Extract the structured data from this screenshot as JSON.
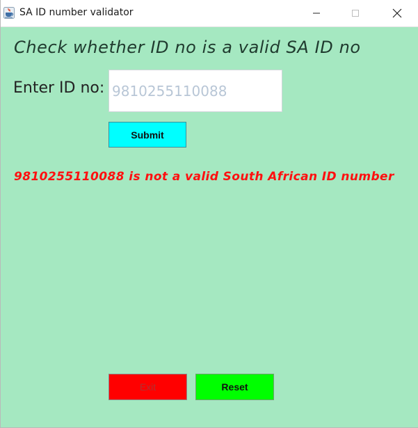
{
  "window": {
    "title": "SA ID number validator",
    "app_icon": "java-coffee-cup-icon",
    "controls": {
      "minimize_icon": "minimize-icon",
      "maximize_icon": "maximize-icon",
      "close_icon": "close-icon"
    }
  },
  "form": {
    "heading": "Check whether ID no is a valid SA ID no",
    "id_label": "Enter ID no:",
    "id_input": {
      "value": "",
      "placeholder": "9810255110088"
    },
    "submit_label": "Submit"
  },
  "result": {
    "message": "9810255110088 is not a valid South African ID number",
    "color": "#ff1010"
  },
  "footer": {
    "exit_label": "Exit",
    "reset_label": "Reset"
  },
  "colors": {
    "background": "#a5e8c1",
    "submit": "#00ffff",
    "exit": "#ff0000",
    "reset": "#00ff00"
  }
}
